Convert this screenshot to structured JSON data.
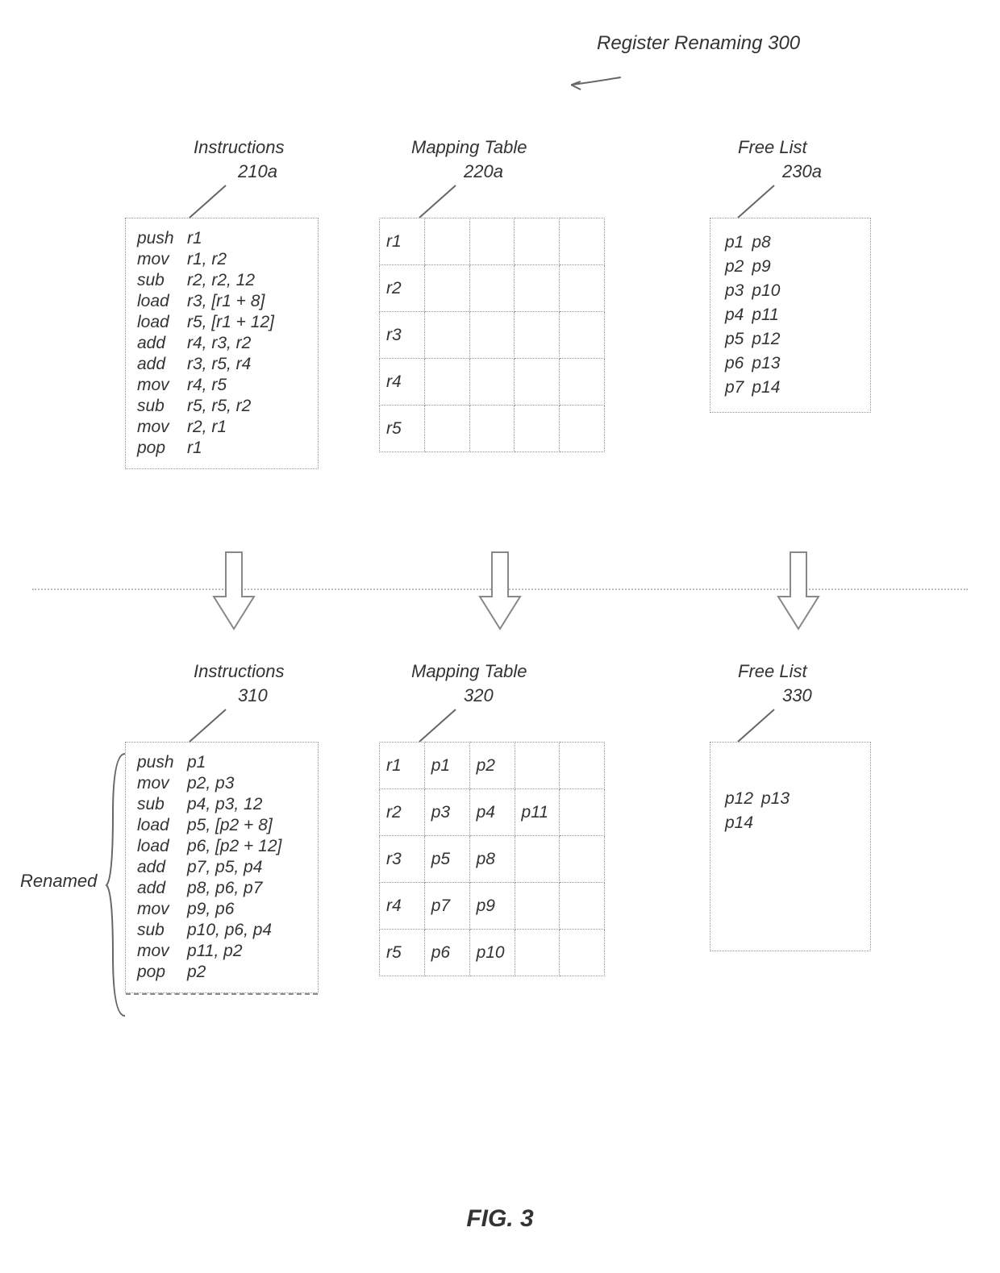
{
  "title": "Register Renaming  300",
  "figure": "FIG. 3",
  "renamed_label": "Renamed",
  "labels": {
    "instructions": "Instructions",
    "mapping_table": "Mapping Table",
    "free_list": "Free List"
  },
  "before": {
    "instr_ref": "210a",
    "map_ref": "220a",
    "list_ref": "230a",
    "instructions": [
      [
        "push",
        "r1"
      ],
      [
        "mov",
        "r1, r2"
      ],
      [
        "sub",
        "r2, r2, 12"
      ],
      [
        "load",
        "r3, [r1 + 8]"
      ],
      [
        "load",
        "r5, [r1 + 12]"
      ],
      [
        "add",
        "r4, r3, r2"
      ],
      [
        "add",
        "r3, r5, r4"
      ],
      [
        "mov",
        "r4, r5"
      ],
      [
        "sub",
        "r5, r5, r2"
      ],
      [
        "mov",
        "r2, r1"
      ],
      [
        "pop",
        "r1"
      ]
    ],
    "mapping": [
      [
        "r1",
        "",
        "",
        "",
        ""
      ],
      [
        "r2",
        "",
        "",
        "",
        ""
      ],
      [
        "r3",
        "",
        "",
        "",
        ""
      ],
      [
        "r4",
        "",
        "",
        "",
        ""
      ],
      [
        "r5",
        "",
        "",
        "",
        ""
      ]
    ],
    "free_list": [
      [
        "p1",
        "p8"
      ],
      [
        "p2",
        "p9"
      ],
      [
        "p3",
        "p10"
      ],
      [
        "p4",
        "p11"
      ],
      [
        "p5",
        "p12"
      ],
      [
        "p6",
        "p13"
      ],
      [
        "p7",
        "p14"
      ]
    ]
  },
  "after": {
    "instr_ref": "310",
    "map_ref": "320",
    "list_ref": "330",
    "instructions": [
      [
        "push",
        "p1"
      ],
      [
        "mov",
        "p2, p3"
      ],
      [
        "sub",
        "p4, p3, 12"
      ],
      [
        "load",
        "p5, [p2 + 8]"
      ],
      [
        "load",
        "p6, [p2 + 12]"
      ],
      [
        "add",
        "p7, p5, p4"
      ],
      [
        "add",
        "p8, p6, p7"
      ],
      [
        "mov",
        "p9, p6"
      ],
      [
        "sub",
        "p10, p6, p4"
      ],
      [
        "mov",
        "p11, p2"
      ],
      [
        "pop",
        "p2"
      ]
    ],
    "mapping": [
      [
        "r1",
        "p1",
        "p2",
        "",
        ""
      ],
      [
        "r2",
        "p3",
        "p4",
        "p11",
        ""
      ],
      [
        "r3",
        "p5",
        "p8",
        "",
        ""
      ],
      [
        "r4",
        "p7",
        "p9",
        "",
        ""
      ],
      [
        "r5",
        "p6",
        "p10",
        "",
        ""
      ]
    ],
    "free_list": [
      [
        "p12",
        "p13"
      ],
      [
        "p14",
        ""
      ]
    ]
  }
}
